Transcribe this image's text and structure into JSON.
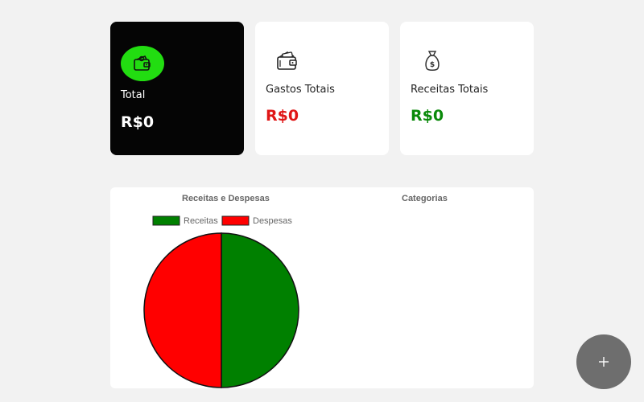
{
  "cards": {
    "total": {
      "label": "Total",
      "value": "R$0",
      "icon": "wallet-icon",
      "icon_bg": "#22dd11"
    },
    "expenses": {
      "label": "Gastos Totais",
      "value": "R$0",
      "icon": "wallet-cash-icon",
      "value_color": "#e01616"
    },
    "income": {
      "label": "Receitas Totais",
      "value": "R$0",
      "icon": "money-bag-icon",
      "value_color": "#0a8a0a"
    }
  },
  "charts": {
    "categories_title": "Categorias"
  },
  "chart_data": {
    "type": "pie",
    "title": "Receitas e Despesas",
    "categories": [
      "Receitas",
      "Despesas"
    ],
    "values": [
      50,
      50
    ],
    "colors": [
      "#008000",
      "#ff0000"
    ],
    "legend": "top"
  },
  "fab": {
    "label": "+"
  }
}
